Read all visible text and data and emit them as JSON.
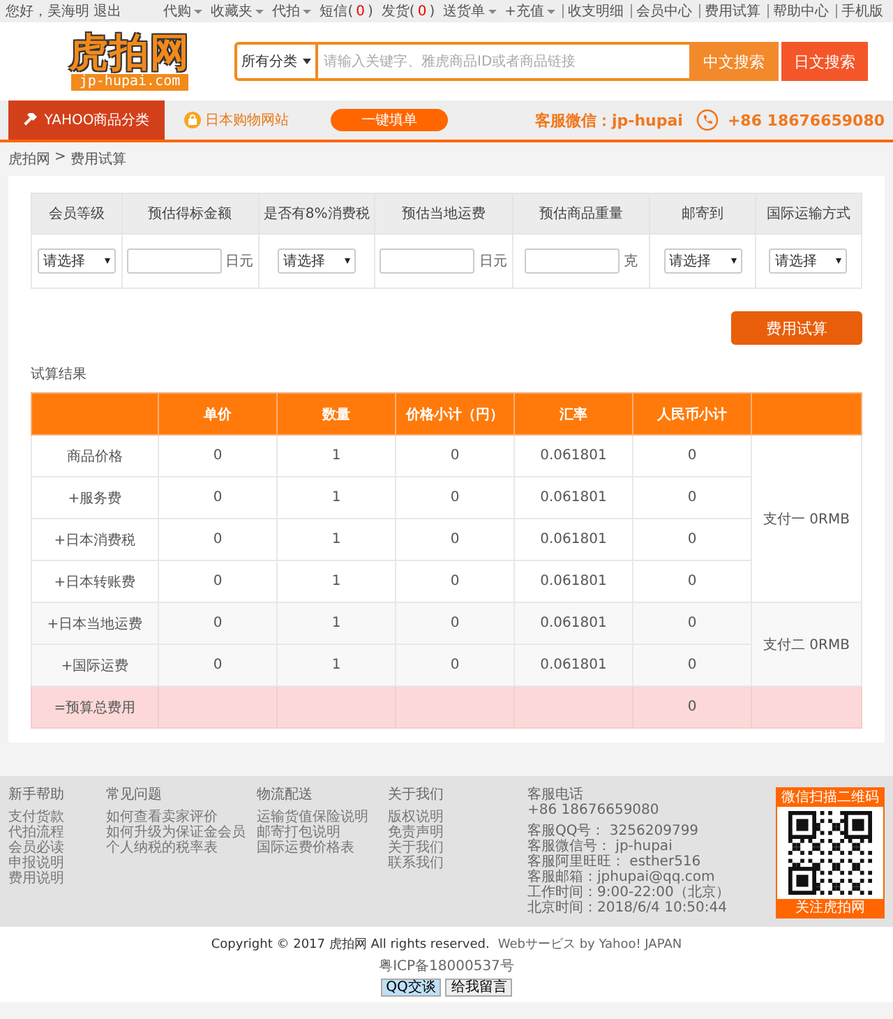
{
  "top_bar": {
    "greeting": "您好，吴海明",
    "logout": "退出",
    "menu": [
      {
        "label": "代购",
        "dropdown": true,
        "divider": false
      },
      {
        "label": "收藏夹",
        "dropdown": true,
        "divider": false
      },
      {
        "label": "代拍",
        "dropdown": true,
        "divider": false
      },
      {
        "label": "短信",
        "open": "(",
        "count": "0",
        "close": ")",
        "dropdown": false,
        "divider": false
      },
      {
        "label": "发货",
        "open": "(",
        "count": "0",
        "close": ")",
        "dropdown": false,
        "divider": false
      },
      {
        "label": "送货单",
        "dropdown": true,
        "divider": false
      },
      {
        "label": "+充值",
        "dropdown": true,
        "divider": false
      },
      {
        "label": "收支明细",
        "dropdown": false,
        "divider": true
      },
      {
        "label": "会员中心",
        "dropdown": false,
        "divider": true
      },
      {
        "label": "费用试算",
        "dropdown": false,
        "divider": true
      },
      {
        "label": "帮助中心",
        "dropdown": false,
        "divider": true
      },
      {
        "label": "手机版",
        "dropdown": false,
        "divider": true
      }
    ]
  },
  "logo": {
    "name": "虎拍网",
    "domain": "jp-hupai.com"
  },
  "search": {
    "category": "所有分类",
    "placeholder": "请输入关键字、雅虎商品ID或者商品链接",
    "buttons": [
      "中文搜索",
      "日文搜索"
    ]
  },
  "nav": {
    "category_button": "YAHOO商品分类",
    "site_link": "日本购物网站",
    "quick_fill": "一键填单",
    "wechat": "客服微信：jp-hupai",
    "phone": "+86 18676659080"
  },
  "breadcrumb": {
    "items": [
      "虎拍网",
      "费用试算"
    ],
    "separator": ">"
  },
  "form": {
    "columns": [
      {
        "header": "会员等级",
        "kind": "select",
        "value": "请选择"
      },
      {
        "header": "预估得标金额",
        "kind": "input",
        "unit": "日元"
      },
      {
        "header": "是否有8%消费税",
        "kind": "select",
        "value": "请选择"
      },
      {
        "header": "预估当地运费",
        "kind": "input",
        "unit": "日元"
      },
      {
        "header": "预估商品重量",
        "kind": "input",
        "unit": "克"
      },
      {
        "header": "邮寄到",
        "kind": "select",
        "value": "请选择"
      },
      {
        "header": "国际运输方式",
        "kind": "select",
        "value": "请选择"
      }
    ],
    "submit": "费用试算"
  },
  "results": {
    "title": "试算结果",
    "columns": [
      "单价",
      "数量",
      "价格小计（円）",
      "汇率",
      "人民币小计"
    ],
    "groups": [
      {
        "payment": "支付一 0RMB",
        "rows": [
          {
            "item": "商品价格",
            "cells": [
              "0",
              "1",
              "0",
              "0.061801",
              "0"
            ]
          },
          {
            "item": "+服务费",
            "cells": [
              "0",
              "1",
              "0",
              "0.061801",
              "0"
            ]
          },
          {
            "item": "+日本消费税",
            "cells": [
              "0",
              "1",
              "0",
              "0.061801",
              "0"
            ]
          },
          {
            "item": "+日本转账费",
            "cells": [
              "0",
              "1",
              "0",
              "0.061801",
              "0"
            ]
          }
        ]
      },
      {
        "payment": "支付二 0RMB",
        "rows": [
          {
            "item": "+日本当地运费",
            "cells": [
              "0",
              "1",
              "0",
              "0.061801",
              "0"
            ]
          },
          {
            "item": "+国际运费",
            "cells": [
              "0",
              "1",
              "0",
              "0.061801",
              "0"
            ]
          }
        ]
      }
    ],
    "total": {
      "label": "=预算总费用",
      "value": "0"
    }
  },
  "footer": {
    "columns": [
      {
        "title": "新手帮助",
        "links": [
          "支付货款",
          "代拍流程",
          "会员必读",
          "申报说明",
          "费用说明"
        ]
      },
      {
        "title": "常见问题",
        "links": [
          "如何查看卖家评价",
          "如何升级为保证金会员",
          "个人纳税的税率表"
        ]
      },
      {
        "title": "物流配送",
        "links": [
          "运输货值保险说明",
          "邮寄打包说明",
          "国际运费价格表"
        ]
      },
      {
        "title": "关于我们",
        "links": [
          "版权说明",
          "免责声明",
          "关于我们",
          "联系我们"
        ]
      }
    ],
    "contact": {
      "title": "客服电话",
      "phone": "+86 18676659080",
      "lines": [
        "客服QQ号： 3256209799",
        "客服微信号： jp-hupai",
        "客服阿里旺旺： esther516",
        "客服邮箱：jphupai@qq.com",
        "工作时间：9:00-22:00（北京）",
        "北京时间：2018/6/4 10:50:44"
      ]
    },
    "qr": {
      "title": "微信扫描二维码",
      "caption": "关注虎拍网"
    }
  },
  "copyright": {
    "text": "Copyright © 2017 虎拍网 All rights reserved.",
    "service": "Webサービス by Yahoo! JAPAN",
    "icp": "粤ICP备18000537号",
    "buttons": [
      "QQ交谈",
      "给我留言"
    ]
  }
}
